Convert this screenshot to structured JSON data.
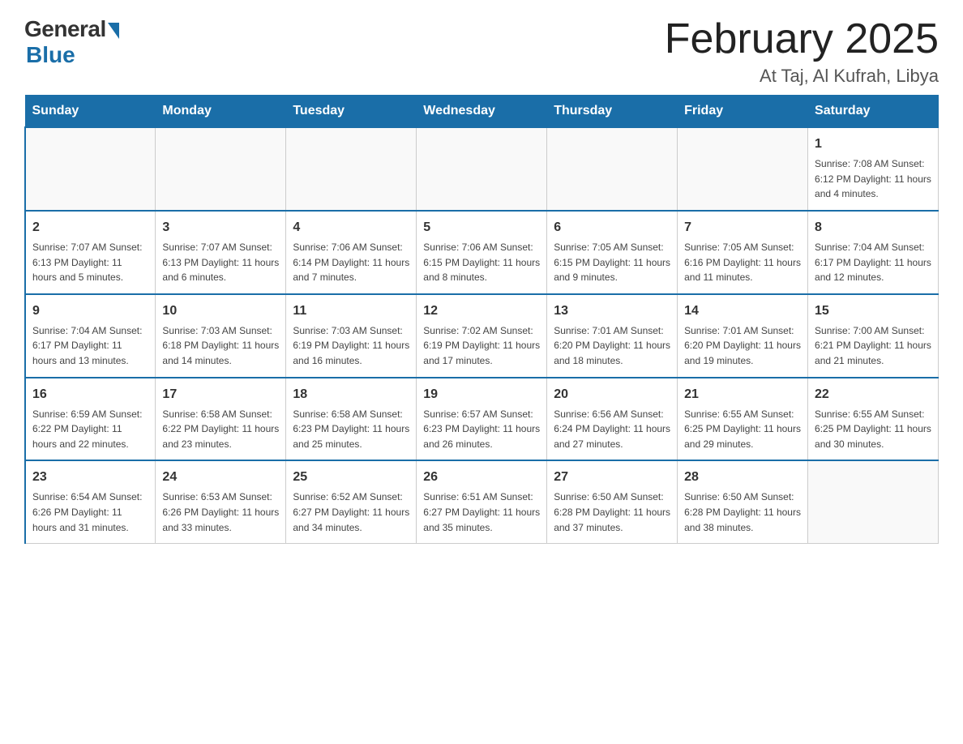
{
  "header": {
    "logo_general": "General",
    "logo_blue": "Blue",
    "title": "February 2025",
    "subtitle": "At Taj, Al Kufrah, Libya"
  },
  "days_of_week": [
    "Sunday",
    "Monday",
    "Tuesday",
    "Wednesday",
    "Thursday",
    "Friday",
    "Saturday"
  ],
  "weeks": [
    [
      {
        "day": "",
        "info": ""
      },
      {
        "day": "",
        "info": ""
      },
      {
        "day": "",
        "info": ""
      },
      {
        "day": "",
        "info": ""
      },
      {
        "day": "",
        "info": ""
      },
      {
        "day": "",
        "info": ""
      },
      {
        "day": "1",
        "info": "Sunrise: 7:08 AM\nSunset: 6:12 PM\nDaylight: 11 hours and 4 minutes."
      }
    ],
    [
      {
        "day": "2",
        "info": "Sunrise: 7:07 AM\nSunset: 6:13 PM\nDaylight: 11 hours and 5 minutes."
      },
      {
        "day": "3",
        "info": "Sunrise: 7:07 AM\nSunset: 6:13 PM\nDaylight: 11 hours and 6 minutes."
      },
      {
        "day": "4",
        "info": "Sunrise: 7:06 AM\nSunset: 6:14 PM\nDaylight: 11 hours and 7 minutes."
      },
      {
        "day": "5",
        "info": "Sunrise: 7:06 AM\nSunset: 6:15 PM\nDaylight: 11 hours and 8 minutes."
      },
      {
        "day": "6",
        "info": "Sunrise: 7:05 AM\nSunset: 6:15 PM\nDaylight: 11 hours and 9 minutes."
      },
      {
        "day": "7",
        "info": "Sunrise: 7:05 AM\nSunset: 6:16 PM\nDaylight: 11 hours and 11 minutes."
      },
      {
        "day": "8",
        "info": "Sunrise: 7:04 AM\nSunset: 6:17 PM\nDaylight: 11 hours and 12 minutes."
      }
    ],
    [
      {
        "day": "9",
        "info": "Sunrise: 7:04 AM\nSunset: 6:17 PM\nDaylight: 11 hours and 13 minutes."
      },
      {
        "day": "10",
        "info": "Sunrise: 7:03 AM\nSunset: 6:18 PM\nDaylight: 11 hours and 14 minutes."
      },
      {
        "day": "11",
        "info": "Sunrise: 7:03 AM\nSunset: 6:19 PM\nDaylight: 11 hours and 16 minutes."
      },
      {
        "day": "12",
        "info": "Sunrise: 7:02 AM\nSunset: 6:19 PM\nDaylight: 11 hours and 17 minutes."
      },
      {
        "day": "13",
        "info": "Sunrise: 7:01 AM\nSunset: 6:20 PM\nDaylight: 11 hours and 18 minutes."
      },
      {
        "day": "14",
        "info": "Sunrise: 7:01 AM\nSunset: 6:20 PM\nDaylight: 11 hours and 19 minutes."
      },
      {
        "day": "15",
        "info": "Sunrise: 7:00 AM\nSunset: 6:21 PM\nDaylight: 11 hours and 21 minutes."
      }
    ],
    [
      {
        "day": "16",
        "info": "Sunrise: 6:59 AM\nSunset: 6:22 PM\nDaylight: 11 hours and 22 minutes."
      },
      {
        "day": "17",
        "info": "Sunrise: 6:58 AM\nSunset: 6:22 PM\nDaylight: 11 hours and 23 minutes."
      },
      {
        "day": "18",
        "info": "Sunrise: 6:58 AM\nSunset: 6:23 PM\nDaylight: 11 hours and 25 minutes."
      },
      {
        "day": "19",
        "info": "Sunrise: 6:57 AM\nSunset: 6:23 PM\nDaylight: 11 hours and 26 minutes."
      },
      {
        "day": "20",
        "info": "Sunrise: 6:56 AM\nSunset: 6:24 PM\nDaylight: 11 hours and 27 minutes."
      },
      {
        "day": "21",
        "info": "Sunrise: 6:55 AM\nSunset: 6:25 PM\nDaylight: 11 hours and 29 minutes."
      },
      {
        "day": "22",
        "info": "Sunrise: 6:55 AM\nSunset: 6:25 PM\nDaylight: 11 hours and 30 minutes."
      }
    ],
    [
      {
        "day": "23",
        "info": "Sunrise: 6:54 AM\nSunset: 6:26 PM\nDaylight: 11 hours and 31 minutes."
      },
      {
        "day": "24",
        "info": "Sunrise: 6:53 AM\nSunset: 6:26 PM\nDaylight: 11 hours and 33 minutes."
      },
      {
        "day": "25",
        "info": "Sunrise: 6:52 AM\nSunset: 6:27 PM\nDaylight: 11 hours and 34 minutes."
      },
      {
        "day": "26",
        "info": "Sunrise: 6:51 AM\nSunset: 6:27 PM\nDaylight: 11 hours and 35 minutes."
      },
      {
        "day": "27",
        "info": "Sunrise: 6:50 AM\nSunset: 6:28 PM\nDaylight: 11 hours and 37 minutes."
      },
      {
        "day": "28",
        "info": "Sunrise: 6:50 AM\nSunset: 6:28 PM\nDaylight: 11 hours and 38 minutes."
      },
      {
        "day": "",
        "info": ""
      }
    ]
  ]
}
